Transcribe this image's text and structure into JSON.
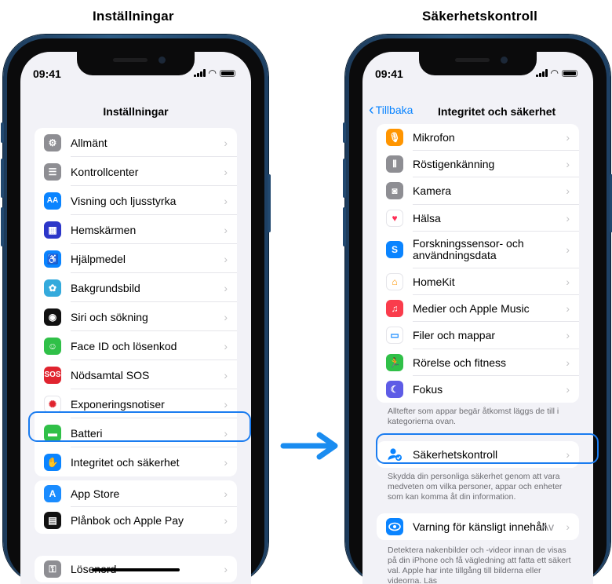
{
  "left": {
    "caption": "Inställningar",
    "time": "09:41",
    "title": "Inställningar",
    "group1": [
      {
        "label": "Allmänt",
        "icon": "gear-icon",
        "color": "#8e8e93"
      },
      {
        "label": "Kontrollcenter",
        "icon": "toggles-icon",
        "color": "#8e8e93"
      },
      {
        "label": "Visning och ljusstyrka",
        "icon": "text-size-icon",
        "color": "#0a84ff"
      },
      {
        "label": "Hemskärmen",
        "icon": "home-grid-icon",
        "color": "#2c36c9"
      },
      {
        "label": "Hjälpmedel",
        "icon": "accessibility-icon",
        "color": "#0a84ff"
      },
      {
        "label": "Bakgrundsbild",
        "icon": "wallpaper-flower-icon",
        "color": "#34aadc"
      },
      {
        "label": "Siri och sökning",
        "icon": "siri-icon",
        "color": "#111111"
      },
      {
        "label": "Face ID och lösenkod",
        "icon": "face-id-icon",
        "color": "#30c048"
      },
      {
        "label": "Nödsamtal SOS",
        "icon": "sos-icon",
        "color": "#e0242f"
      },
      {
        "label": "Exponeringsnotiser",
        "icon": "exposure-icon",
        "color": "#ffffff"
      },
      {
        "label": "Batteri",
        "icon": "battery-icon",
        "color": "#30c048"
      },
      {
        "label": "Integritet och säkerhet",
        "icon": "hand-icon",
        "color": "#0a84ff"
      }
    ],
    "group2": [
      {
        "label": "App Store",
        "icon": "app-store-icon",
        "color": "#1a8cff"
      },
      {
        "label": "Plånbok och Apple Pay",
        "icon": "wallet-icon",
        "color": "#111111"
      }
    ],
    "group3": [
      {
        "label": "Lösenord",
        "icon": "key-icon",
        "color": "#8e8e93"
      }
    ]
  },
  "right": {
    "caption": "Säkerhetskontroll",
    "time": "09:41",
    "back_label": "Tillbaka",
    "title": "Integritet och säkerhet",
    "group1": [
      {
        "label": "Mikrofon",
        "icon": "microphone-icon",
        "color": "#ff9500"
      },
      {
        "label": "Röstigenkänning",
        "icon": "waveform-icon",
        "color": "#8e8e93"
      },
      {
        "label": "Kamera",
        "icon": "camera-icon",
        "color": "#8e8e93"
      },
      {
        "label": "Hälsa",
        "icon": "heart-icon",
        "color": "#ffffff"
      },
      {
        "label": "Forskningssensor- och användningsdata",
        "icon": "research-icon",
        "color": "#0a84ff"
      },
      {
        "label": "HomeKit",
        "icon": "homekit-icon",
        "color": "#ffffff"
      },
      {
        "label": "Medier och Apple Music",
        "icon": "music-icon",
        "color": "#fa3c4c"
      },
      {
        "label": "Filer och mappar",
        "icon": "folder-icon",
        "color": "#ffffff"
      },
      {
        "label": "Rörelse och fitness",
        "icon": "running-icon",
        "color": "#30c048"
      },
      {
        "label": "Fokus",
        "icon": "moon-icon",
        "color": "#5e5ce6"
      }
    ],
    "note1": "Alltefter som appar begär åtkomst läggs de till i kategorierna ovan.",
    "safety": {
      "label": "Säkerhetskontroll",
      "icon": "safety-check-icon"
    },
    "note2": "Skydda din personliga säkerhet genom att vara medveten om vilka personer, appar och enheter som kan komma åt din information.",
    "sensitive": {
      "label": "Varning för känsligt innehåll",
      "value": "Av",
      "icon": "eye-warning-icon"
    },
    "note3": "Detektera nakenbilder och -videor innan de visas på din iPhone och få vägledning att fatta ett säkert val. Apple har inte tillgång till bilderna eller videorna. Läs"
  }
}
